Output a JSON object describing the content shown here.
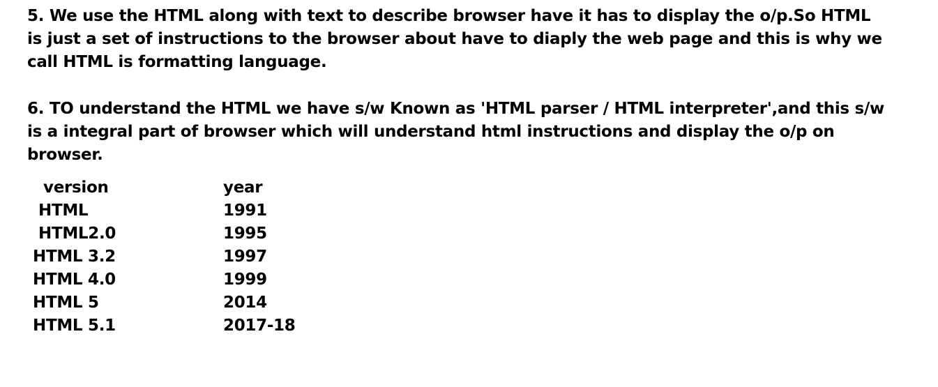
{
  "paragraphs": {
    "p5": {
      "lines": [
        "5. We use the HTML along with text to describe browser have it has to display the o/p.So HTML",
        "is just a set of instructions to the browser about have to diaply the web page and this is why we",
        "call HTML is formatting language."
      ]
    },
    "p6": {
      "lines": [
        "6. TO understand the HTML we have s/w Known as  'HTML parser / HTML interpreter',and this s/w",
        "is a integral part of browser which will understand html instructions and display the o/p on",
        "browser."
      ]
    }
  },
  "table": {
    "headers": {
      "version": "version",
      "year": "year"
    },
    "rows": [
      {
        "version": "HTML",
        "year": "1991"
      },
      {
        "version": "HTML2.0",
        "year": "1995"
      },
      {
        "version": "HTML 3.2",
        "year": "1997"
      },
      {
        "version": "HTML 4.0",
        "year": "1999"
      },
      {
        "version": "HTML 5",
        "year": "2014"
      },
      {
        "version": "HTML 5.1",
        "year": "2017-18"
      }
    ]
  }
}
